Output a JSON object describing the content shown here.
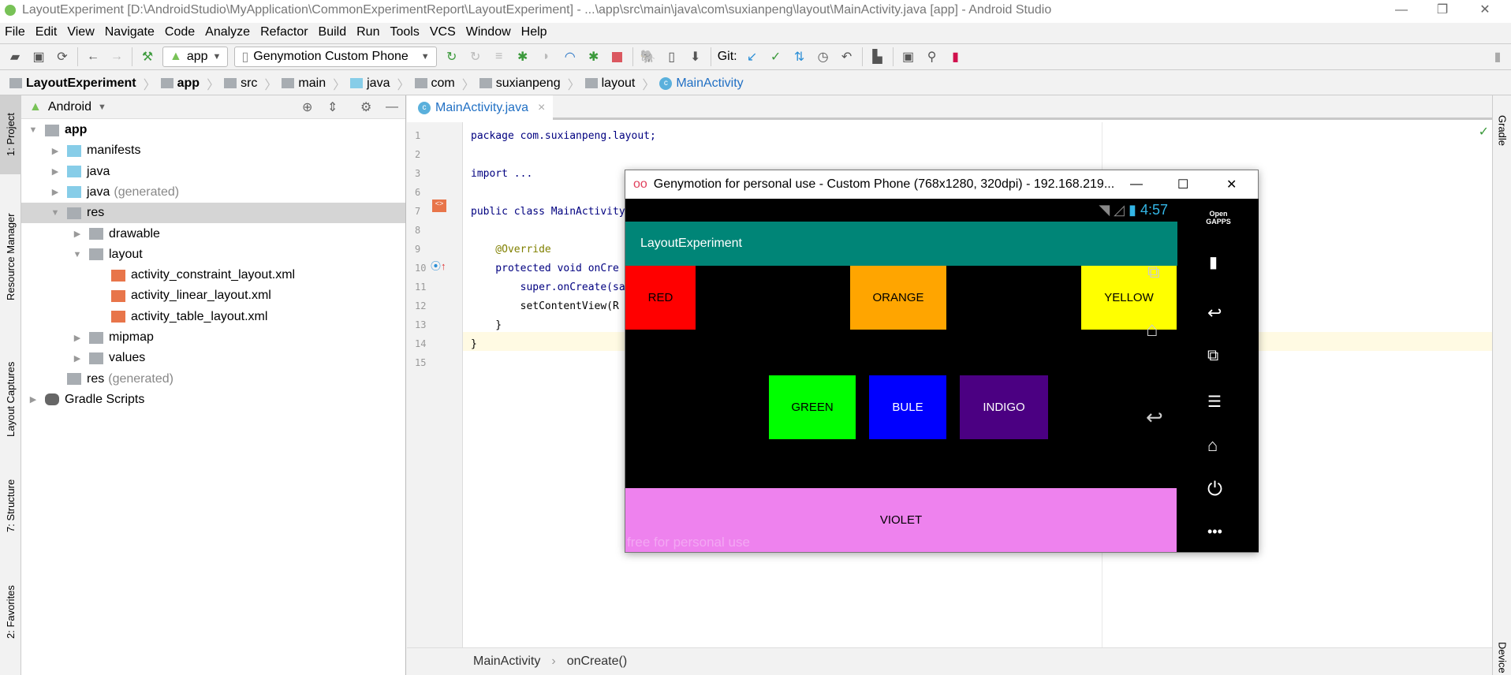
{
  "window": {
    "title": "LayoutExperiment [D:\\AndroidStudio\\MyApplication\\CommonExperimentReport\\LayoutExperiment] - ...\\app\\src\\main\\java\\com\\suxianpeng\\layout\\MainActivity.java [app] - Android Studio",
    "minimize": "—",
    "maximize": "❐",
    "close": "✕"
  },
  "menu": [
    "File",
    "Edit",
    "View",
    "Navigate",
    "Code",
    "Analyze",
    "Refactor",
    "Build",
    "Run",
    "Tools",
    "VCS",
    "Window",
    "Help"
  ],
  "toolbar": {
    "config": "app",
    "device": "Genymotion Custom Phone",
    "git_label": "Git:"
  },
  "breadcrumb": [
    "LayoutExperiment",
    "app",
    "src",
    "main",
    "java",
    "com",
    "suxianpeng",
    "layout",
    "MainActivity"
  ],
  "left_tabs": [
    "1: Project",
    "Resource Manager",
    "Layout Captures",
    "7: Structure",
    "2: Favorites"
  ],
  "right_tabs": [
    "Gradle",
    "Device"
  ],
  "project": {
    "view": "Android",
    "tree": [
      {
        "label": "app",
        "depth": 0,
        "open": true,
        "bold": true
      },
      {
        "label": "manifests",
        "depth": 1
      },
      {
        "label": "java",
        "depth": 1
      },
      {
        "label": "java",
        "suffix": "(generated)",
        "depth": 1
      },
      {
        "label": "res",
        "depth": 1,
        "open": true,
        "selected": true
      },
      {
        "label": "drawable",
        "depth": 2
      },
      {
        "label": "layout",
        "depth": 2,
        "open": true
      },
      {
        "label": "activity_constraint_layout.xml",
        "depth": 3,
        "file": true
      },
      {
        "label": "activity_linear_layout.xml",
        "depth": 3,
        "file": true
      },
      {
        "label": "activity_table_layout.xml",
        "depth": 3,
        "file": true
      },
      {
        "label": "mipmap",
        "depth": 2
      },
      {
        "label": "values",
        "depth": 2
      },
      {
        "label": "res",
        "suffix": "(generated)",
        "depth": 1,
        "leaf": true
      },
      {
        "label": "Gradle Scripts",
        "depth": 0
      }
    ]
  },
  "editor": {
    "tab": "MainActivity.java",
    "tab_close": "×",
    "line_numbers": [
      "1",
      "2",
      "3",
      "6",
      "7",
      "8",
      "9",
      "10",
      "11",
      "12",
      "13",
      "14",
      "15"
    ],
    "lines": [
      "package com.suxianpeng.layout;",
      "",
      "import ...",
      "",
      "public class MainActivity",
      "",
      "    @Override",
      "    protected void onCre",
      "        super.onCreate(sa",
      "        setContentView(R",
      "    }",
      "}",
      ""
    ],
    "breadcrumb": [
      "MainActivity",
      "onCreate()"
    ]
  },
  "genymotion": {
    "title": "Genymotion for personal use - Custom Phone (768x1280, 320dpi) - 192.168.219...",
    "time": "4:57",
    "app_title": "LayoutExperiment",
    "watermark": "free for personal use",
    "opengapps": "Open GAPPS",
    "boxes": [
      {
        "label": "RED",
        "color": "#ff0000",
        "text": "#000"
      },
      {
        "label": "ORANGE",
        "color": "#ffa500",
        "text": "#000"
      },
      {
        "label": "YELLOW",
        "color": "#ffff00",
        "text": "#000"
      },
      {
        "label": "GREEN",
        "color": "#00ff00",
        "text": "#000"
      },
      {
        "label": "BULE",
        "color": "#0000ff",
        "text": "#fff"
      },
      {
        "label": "INDIGO",
        "color": "#4b0082",
        "text": "#fff"
      },
      {
        "label": "VIOLET",
        "color": "#ee82ee",
        "text": "#000"
      }
    ]
  }
}
